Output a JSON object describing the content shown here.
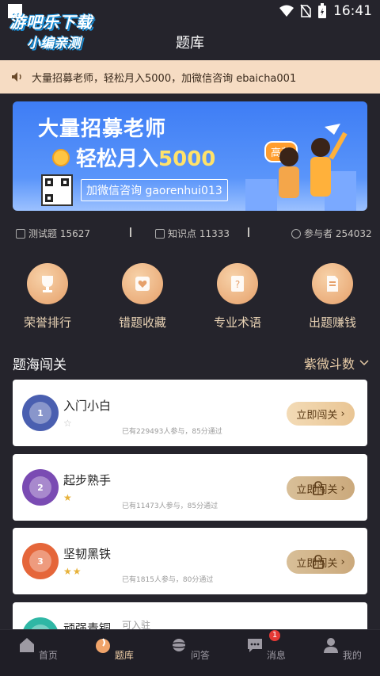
{
  "status": {
    "time": "16:41"
  },
  "watermark": {
    "line1": "游吧乐下载",
    "line2": "小编亲测"
  },
  "header": {
    "title": "题库"
  },
  "notice": {
    "text": "大量招募老师，轻松月入5000，加微信咨询 ebaicha001"
  },
  "banner": {
    "line1": "大量招募老师",
    "line2_prefix": "轻松月入",
    "line2_num": "5000",
    "wechat": "加微信咨询 gaorenhui013",
    "salary_tag": "高薪"
  },
  "stats": {
    "tests": "测试题 15627",
    "knowledge": "知识点 11333",
    "participants": "参与者 254032"
  },
  "quick": [
    {
      "label": "荣誉排行",
      "icon": "trophy-icon"
    },
    {
      "label": "错题收藏",
      "icon": "heart-icon"
    },
    {
      "label": "专业术语",
      "icon": "question-icon"
    },
    {
      "label": "出题赚钱",
      "icon": "edit-doc-icon"
    }
  ],
  "section": {
    "title": "题海闯关",
    "level": "紫微斗数"
  },
  "levels": [
    {
      "name": "入门小白",
      "stars": "☆",
      "info": "已有229493人参与，85分通过",
      "btn": "立即闯关",
      "color": "#4a5fb0"
    },
    {
      "name": "起步熟手",
      "stars": "★",
      "info": "已有11473人参与，85分通过",
      "btn": "立即闯关",
      "color": "#7a4bb3"
    },
    {
      "name": "坚韧黑铁",
      "stars": "★★",
      "info": "已有1815人参与，80分通过",
      "btn": "立即闯关",
      "color": "#e5663a"
    },
    {
      "name": "顽强青铜",
      "stars": "",
      "info": "",
      "btn": "",
      "color": "#2fb7a5"
    }
  ],
  "join_text": "可入驻",
  "nav": [
    {
      "label": "首页"
    },
    {
      "label": "题库"
    },
    {
      "label": "问答"
    },
    {
      "label": "消息",
      "badge": "1"
    },
    {
      "label": "我的"
    }
  ],
  "colors": {
    "accent": "#e9cda8",
    "bg": "#25242c",
    "notice": "#f6dcc3",
    "banner": "#3e7df5"
  }
}
